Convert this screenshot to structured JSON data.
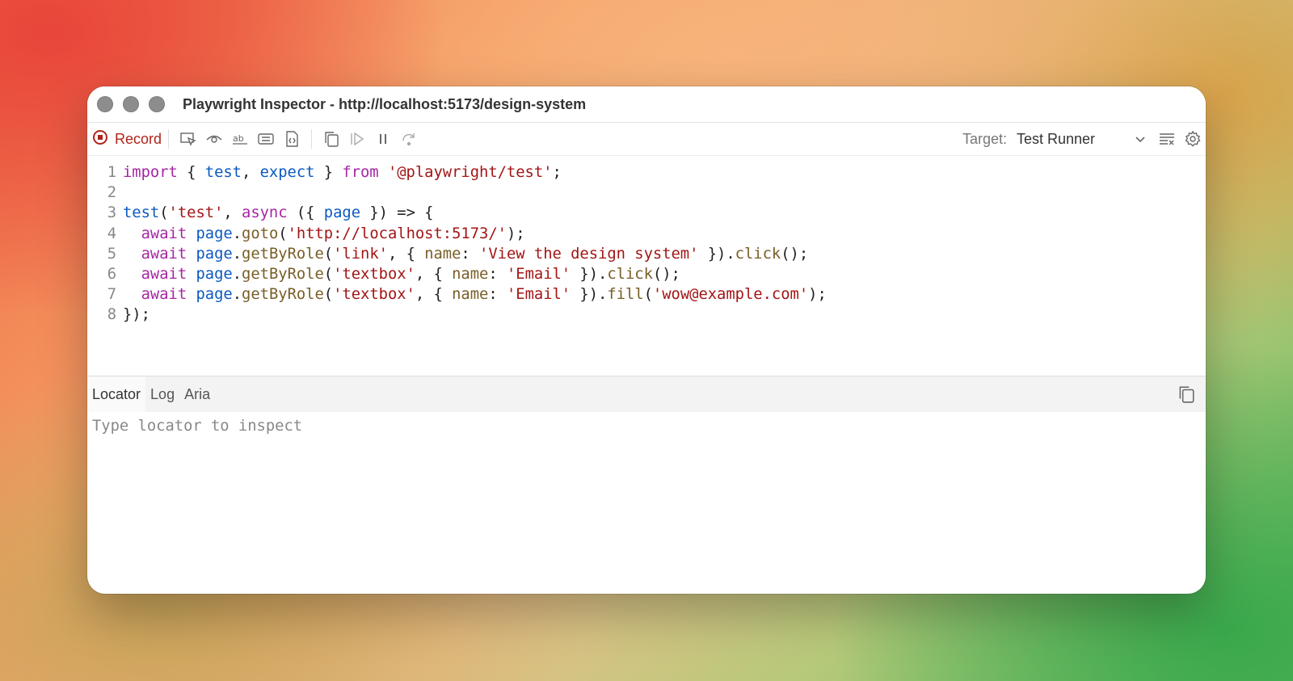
{
  "window": {
    "title": "Playwright Inspector - http://localhost:5173/design-system"
  },
  "toolbar": {
    "record_label": "Record",
    "icons": [
      "record-icon",
      "pick-locator-icon",
      "assert-visibility-icon",
      "assert-text-icon",
      "assert-value-icon",
      "assert-snapshot-icon",
      "copy-icon",
      "resume-icon",
      "pause-icon",
      "step-over-icon",
      "clear-icon",
      "settings-icon"
    ],
    "target_label": "Target:",
    "target_value": "Test Runner"
  },
  "editor": {
    "line_numbers": [
      "1",
      "2",
      "3",
      "4",
      "5",
      "6",
      "7",
      "8"
    ]
  },
  "tabs": {
    "items": [
      "Locator",
      "Log",
      "Aria"
    ],
    "active": "Locator"
  },
  "locator": {
    "placeholder": "Type locator to inspect"
  },
  "colors": {
    "record": "#b0241a",
    "keyword": "#a626a4",
    "identifier": "#0b59c2",
    "string": "#a31515",
    "method": "#795e26"
  }
}
